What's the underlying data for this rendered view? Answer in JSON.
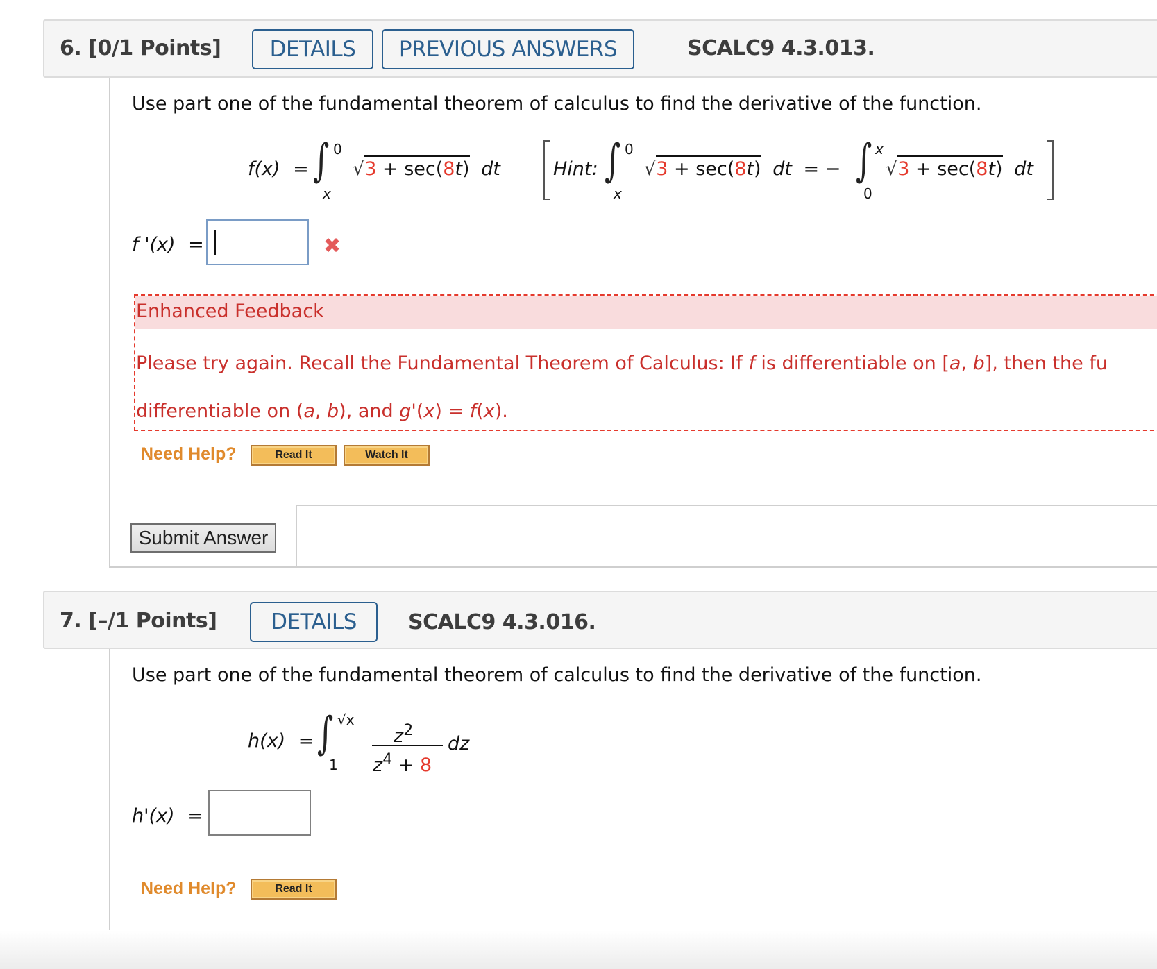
{
  "questions": [
    {
      "number": "6.",
      "points": "[0/1 Points]",
      "buttons": {
        "details": "DETAILS",
        "previous_answers": "PREVIOUS ANSWERS"
      },
      "code": "SCALC9 4.3.013.",
      "prompt": "Use part one of the fundamental theorem of calculus to find the derivative of the function.",
      "function": {
        "lhs": "f(x)",
        "equals": "=",
        "upper_limit": "0",
        "lower_limit": "x",
        "integrand_const": "3",
        "integrand_rest_a": " + sec(",
        "integrand_coef": "8",
        "integrand_var": "t",
        "integrand_rest_b": ")",
        "differential": "dt"
      },
      "hint": {
        "label": "Hint:",
        "upper_left": "0",
        "lower_left": "x",
        "equals_neg": "= −",
        "upper_right": "x",
        "lower_right": "0",
        "differential": "dt"
      },
      "answer": {
        "label": "f '(x)",
        "equals": "=",
        "value": "",
        "status": "incorrect",
        "status_icon": "✖"
      },
      "feedback": {
        "title": "Enhanced Feedback",
        "line1_a": "Please try again. Recall the Fundamental Theorem of Calculus: If ",
        "line1_f": "f",
        "line1_b": " is differentiable on [",
        "line1_a2": "a",
        "line1_comma": ", ",
        "line1_b2": "b",
        "line1_c": "], then the fu",
        "line2_a": "differentiable on (",
        "line2_a2": "a",
        "line2_comma": ", ",
        "line2_b2": "b",
        "line2_b": "), and ",
        "line2_g": "g",
        "line2_c": "'(",
        "line2_x": "x",
        "line2_d": ") = ",
        "line2_f": "f",
        "line2_e": "(",
        "line2_x2": "x",
        "line2_end": ")."
      },
      "help": {
        "label": "Need Help?",
        "read_it": "Read It",
        "watch_it": "Watch It"
      },
      "submit_label": "Submit Answer"
    },
    {
      "number": "7.",
      "points": "[–/1 Points]",
      "buttons": {
        "details": "DETAILS"
      },
      "code": "SCALC9 4.3.016.",
      "prompt": "Use part one of the fundamental theorem of calculus to find the derivative of the function.",
      "function": {
        "lhs": "h(x)",
        "equals": "=",
        "upper_limit": "√x",
        "lower_limit": "1",
        "numerator": "z",
        "numerator_exp": "2",
        "denominator": "z",
        "denominator_exp": "4",
        "denominator_plus": " + ",
        "denominator_const": "8",
        "differential": "dz"
      },
      "answer": {
        "label": "h'(x)",
        "equals": "=",
        "value": ""
      },
      "help": {
        "label": "Need Help?",
        "read_it": "Read It"
      }
    }
  ],
  "colors": {
    "accent_blue": "#2b5f8f",
    "feedback_red": "#c9302c",
    "highlight_red": "#e53a2d",
    "help_orange": "#e08a2c"
  }
}
